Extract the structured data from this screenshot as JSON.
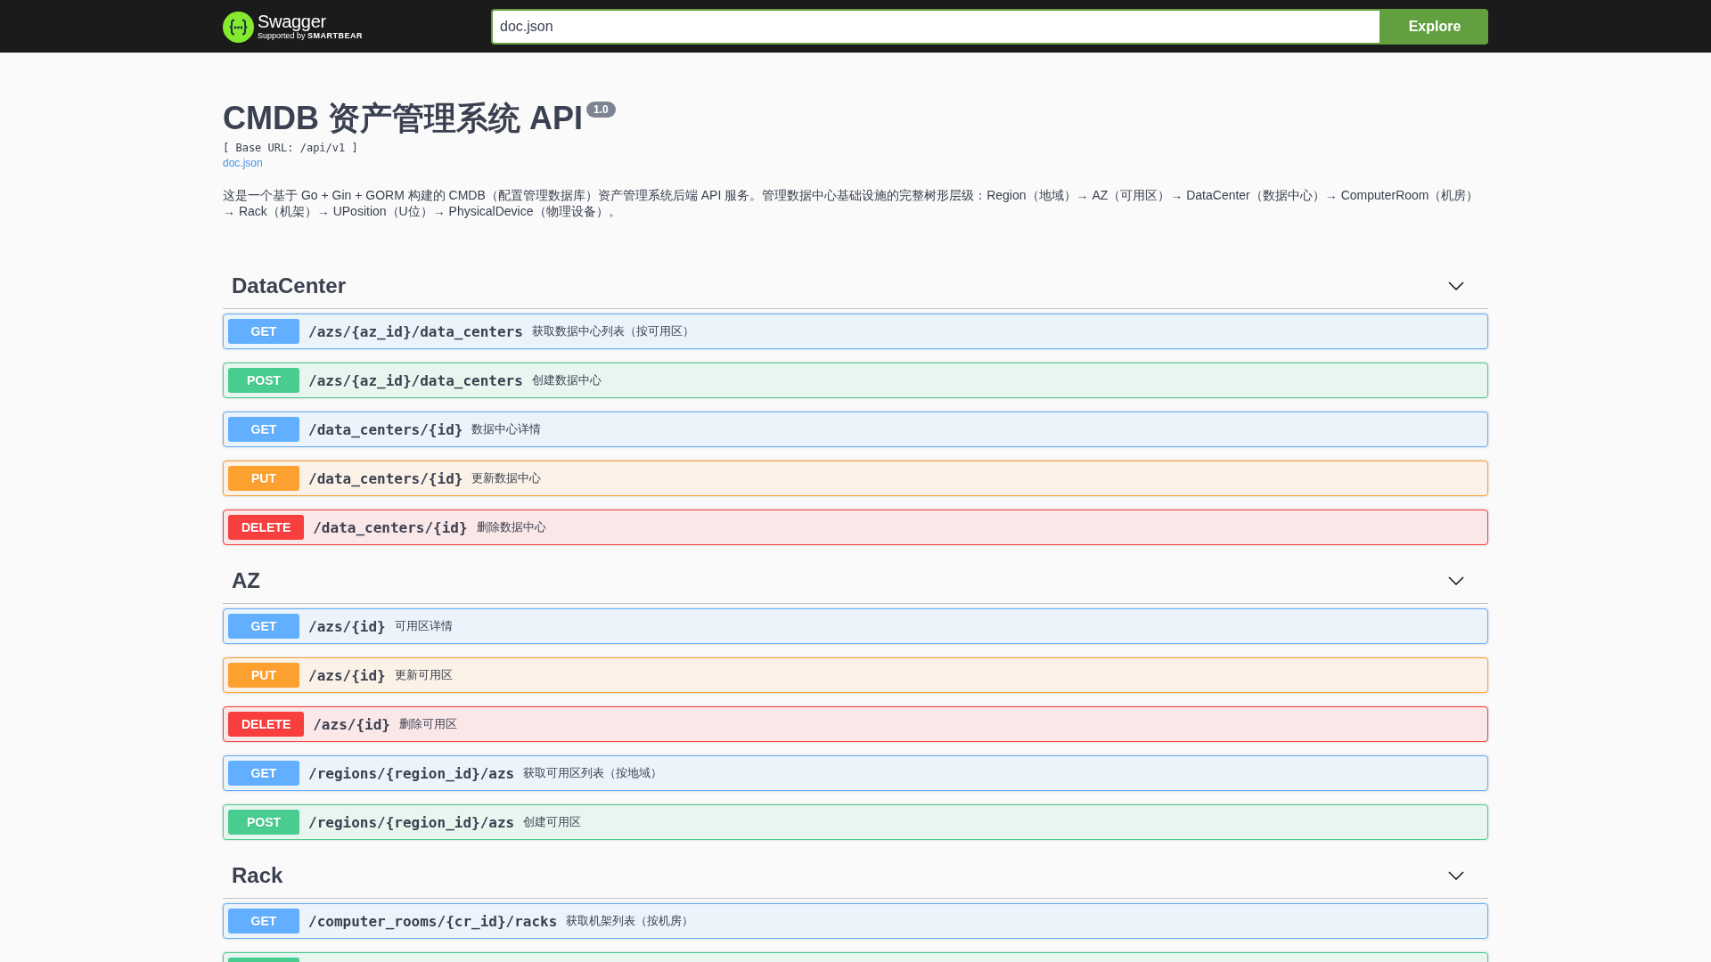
{
  "topbar": {
    "logo": {
      "name": "Swagger",
      "tagline": "Supported by **SMARTBEAR**"
    },
    "url_field": {
      "value": "doc.json"
    },
    "explore_button": "Explore"
  },
  "info": {
    "title": "CMDB 资产管理系统 API",
    "version": "1.0",
    "base_url": "[ Base URL: /api/v1 ]",
    "spec_link": "doc.json",
    "description": "这是一个基于 Go + Gin + GORM 构建的 CMDB（配置管理数据库）资产管理系统后端 API 服务。管理数据中心基础设施的完整树形层级：Region（地域）→ AZ（可用区）→ DataCenter（数据中心）→ ComputerRoom（机房）→ Rack（机架）→ UPosition（U位）→ PhysicalDevice（物理设备）。"
  },
  "sections": [
    {
      "name": "DataCenter",
      "expanded": true,
      "operations": [
        {
          "kind": "get",
          "method": "GET",
          "path": "/azs/{az_id}/data_centers",
          "summary": "获取数据中心列表（按可用区）"
        },
        {
          "kind": "post",
          "method": "POST",
          "path": "/azs/{az_id}/data_centers",
          "summary": "创建数据中心"
        },
        {
          "kind": "get",
          "method": "GET",
          "path": "/data_centers/{id}",
          "summary": "数据中心详情"
        },
        {
          "kind": "put",
          "method": "PUT",
          "path": "/data_centers/{id}",
          "summary": "更新数据中心"
        },
        {
          "kind": "delete",
          "method": "DELETE",
          "path": "/data_centers/{id}",
          "summary": "删除数据中心"
        }
      ]
    },
    {
      "name": "AZ",
      "expanded": true,
      "operations": [
        {
          "kind": "get",
          "method": "GET",
          "path": "/azs/{id}",
          "summary": "可用区详情"
        },
        {
          "kind": "put",
          "method": "PUT",
          "path": "/azs/{id}",
          "summary": "更新可用区"
        },
        {
          "kind": "delete",
          "method": "DELETE",
          "path": "/azs/{id}",
          "summary": "删除可用区"
        },
        {
          "kind": "get",
          "method": "GET",
          "path": "/regions/{region_id}/azs",
          "summary": "获取可用区列表（按地域）"
        },
        {
          "kind": "post",
          "method": "POST",
          "path": "/regions/{region_id}/azs",
          "summary": "创建可用区"
        }
      ]
    },
    {
      "name": "Rack",
      "expanded": true,
      "operations": [
        {
          "kind": "get",
          "method": "GET",
          "path": "/computer_rooms/{cr_id}/racks",
          "summary": "获取机架列表（按机房）"
        },
        {
          "kind": "post"
        }
      ]
    }
  ]
}
